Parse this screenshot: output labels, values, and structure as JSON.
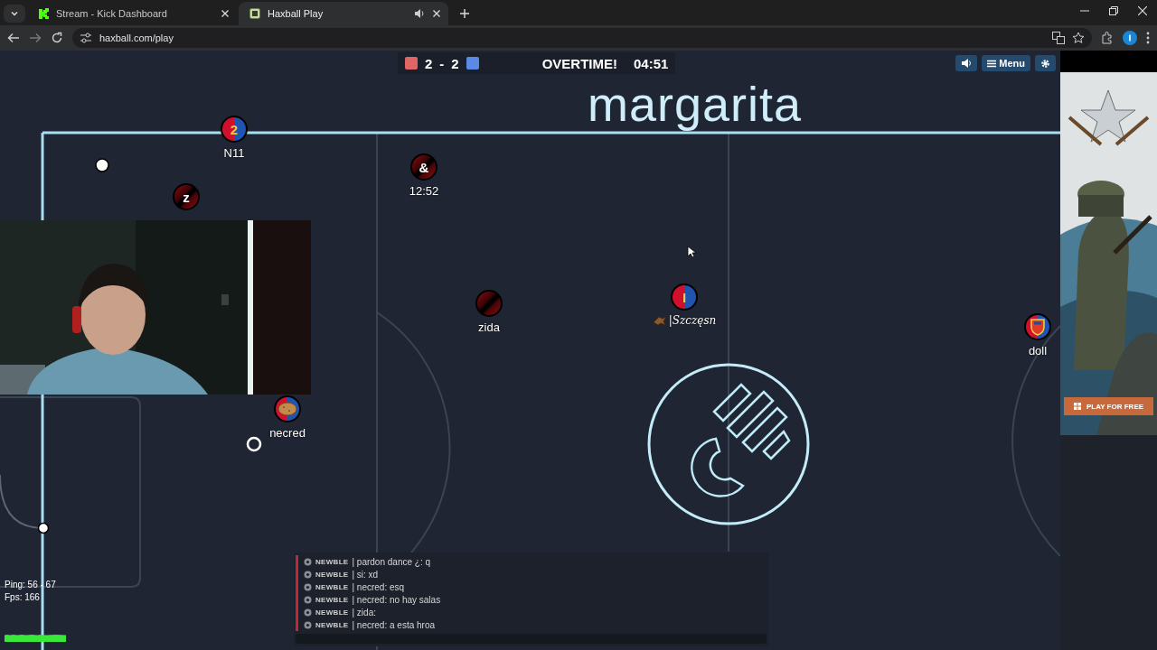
{
  "browser": {
    "tabs": [
      {
        "title": "Stream - Kick Dashboard",
        "selected": false,
        "audio": false
      },
      {
        "title": "Haxball Play",
        "selected": true,
        "audio": true
      }
    ],
    "url": "haxball.com/play"
  },
  "scoreboard": {
    "teams": [
      {
        "color": "#e06666",
        "score": "2"
      },
      {
        "color": "#5a8ae6",
        "score": "2"
      }
    ],
    "separator": "-",
    "status": "OVERTIME!",
    "clock": "04:51"
  },
  "room_title": "margarita",
  "controls": {
    "menu": "Menu"
  },
  "players": [
    {
      "avatar": "2",
      "name": "N11",
      "kind": "split"
    },
    {
      "avatar": "z",
      "kind": "dark"
    },
    {
      "avatar": "&",
      "name": "12:52",
      "kind": "dark"
    },
    {
      "name": "zida",
      "kind": "dark"
    },
    {
      "avatar": "I",
      "name": "|Szczęsn",
      "kind": "split",
      "flair": true
    },
    {
      "name": "necred",
      "kind": "food"
    },
    {
      "name": "doll",
      "kind": "crest"
    }
  ],
  "chat": [
    {
      "tag": "NEWBLE",
      "text": "| pardon dance ¿: q"
    },
    {
      "tag": "NEWBLE",
      "text": "| si: xd"
    },
    {
      "tag": "NEWBLE",
      "text": "| necred: esq"
    },
    {
      "tag": "NEWBLE",
      "text": "| necred: no hay salas"
    },
    {
      "tag": "NEWBLE",
      "text": "| zida:"
    },
    {
      "tag": "NEWBLE",
      "text": "| necred: a esta hroa"
    }
  ],
  "stats": {
    "ping": "Ping: 56 - 67",
    "fps": "Fps: 166"
  },
  "ad": {
    "kind": "picture",
    "button": "PLAY FOR FREE"
  }
}
